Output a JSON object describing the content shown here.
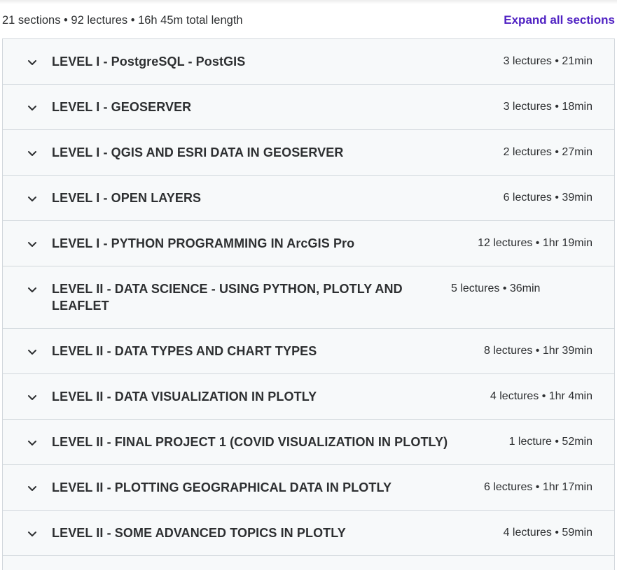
{
  "summary": {
    "text": "21 sections • 92 lectures • 16h 45m total length",
    "expand_label": "Expand all sections"
  },
  "colors": {
    "accent": "#5022c3",
    "section_bg": "#f7f9fa",
    "border": "#d1d7dc",
    "text": "#2d2f31"
  },
  "icons": {
    "section_toggle": "chevron-down-icon"
  },
  "sections": [
    {
      "title": "LEVEL I - PostgreSQL - PostGIS",
      "meta": "3 lectures • 21min"
    },
    {
      "title": "LEVEL I - GEOSERVER",
      "meta": "3 lectures • 18min"
    },
    {
      "title": "LEVEL I - QGIS AND ESRI DATA IN GEOSERVER",
      "meta": "2 lectures • 27min"
    },
    {
      "title": "LEVEL I - OPEN LAYERS",
      "meta": "6 lectures • 39min"
    },
    {
      "title": "LEVEL I - PYTHON PROGRAMMING IN ArcGIS Pro",
      "meta": "12 lectures • 1hr 19min"
    },
    {
      "title": "LEVEL II - DATA SCIENCE - USING PYTHON, PLOTLY AND LEAFLET",
      "meta": "5 lectures • 36min"
    },
    {
      "title": "LEVEL II - DATA TYPES AND CHART TYPES",
      "meta": "8 lectures • 1hr 39min"
    },
    {
      "title": "LEVEL II - DATA VISUALIZATION IN PLOTLY",
      "meta": "4 lectures • 1hr 4min"
    },
    {
      "title": "LEVEL II - FINAL PROJECT 1 (COVID VISUALIZATION IN PLOTLY)",
      "meta": "1 lecture • 52min"
    },
    {
      "title": "LEVEL II - PLOTTING GEOGRAPHICAL DATA IN PLOTLY",
      "meta": "6 lectures • 1hr 17min"
    },
    {
      "title": "LEVEL II - SOME ADVANCED TOPICS IN PLOTLY",
      "meta": "4 lectures • 59min"
    }
  ]
}
